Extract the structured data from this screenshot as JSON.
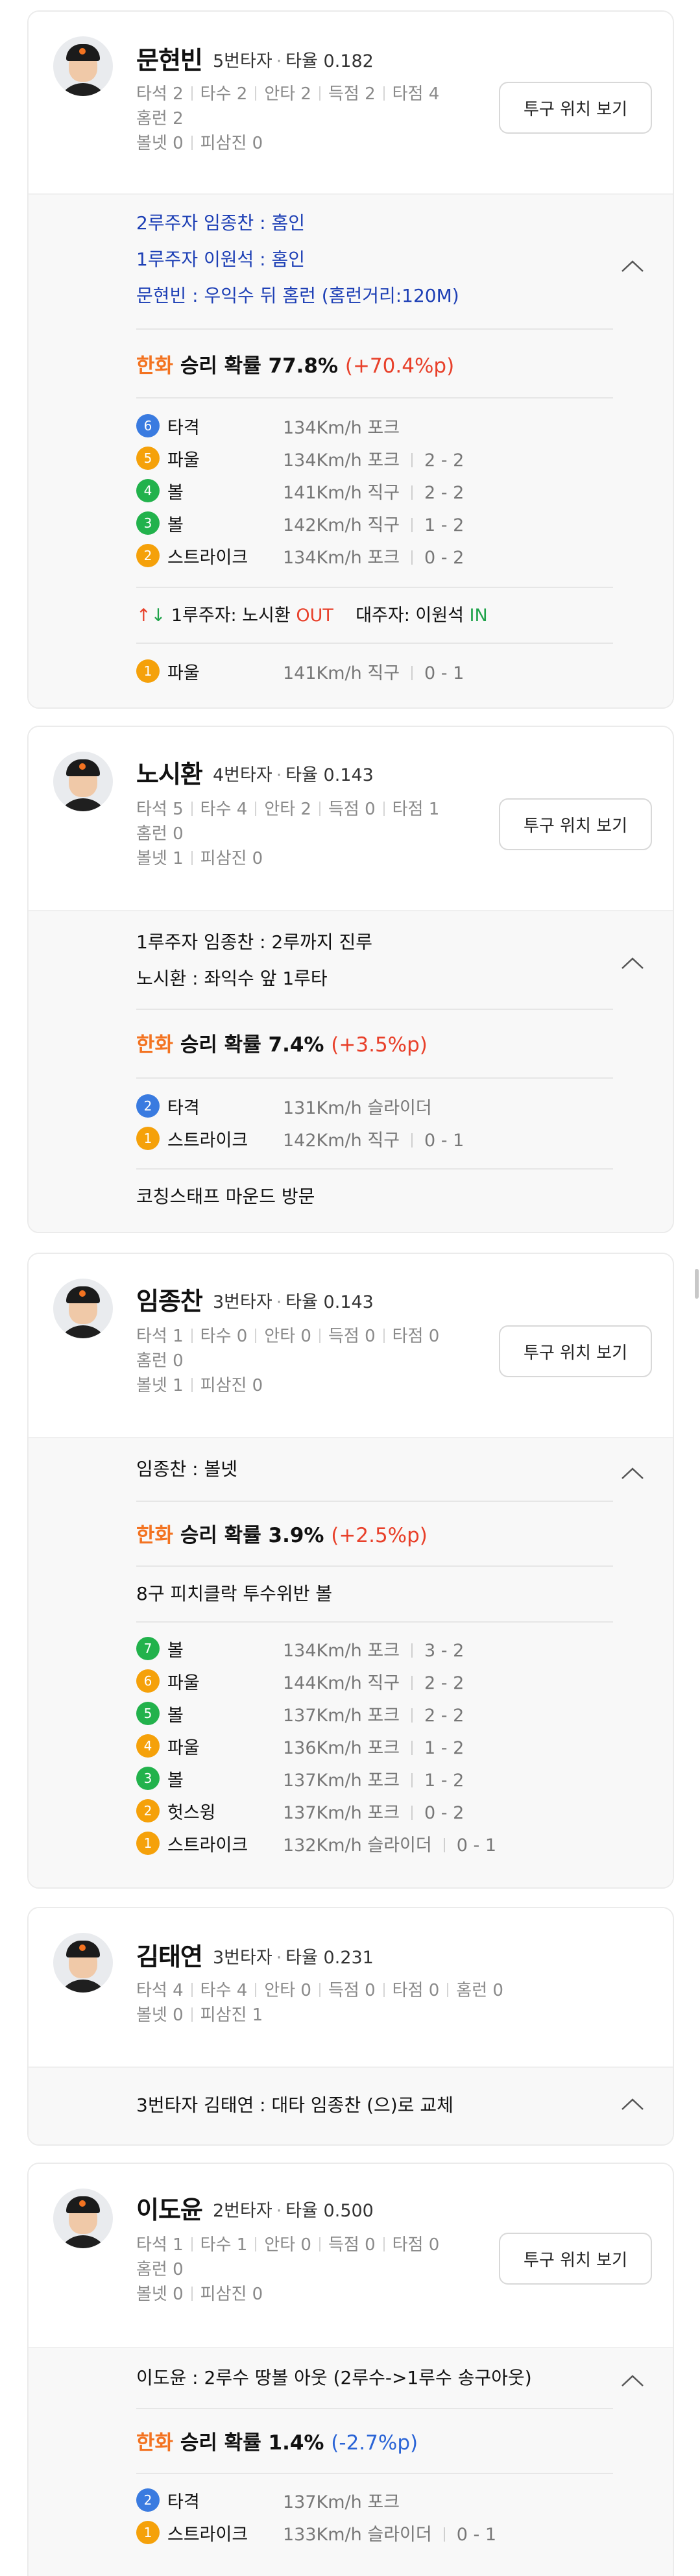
{
  "colors": {
    "team_orange": "#f37321",
    "gain_red": "#e8402a",
    "loss_blue": "#2a64d6",
    "text_blue": "#1d3fb5",
    "strike_orange": "#f5a10a",
    "ball_green": "#22b24c",
    "hit_blue": "#3a7be0",
    "foul_orange": "#f5a10a",
    "swing_orange": "#f5a10a"
  },
  "pitch_button_label": "투구 위치 보기",
  "batters": [
    {
      "name": "문현빈",
      "order": "5번타자",
      "avg": "타율 0.182",
      "stats": [
        "타석 2",
        "타수 2",
        "안타 2",
        "득점 2",
        "타점 4",
        "홈런 2",
        "볼넷 0",
        "피삼진 0"
      ],
      "lines": [
        "2루주자 임종찬 : 홈인",
        "1루주자 이원석 : 홈인",
        "문현빈 : 우익수 뒤 홈런 (홈런거리:120M)"
      ],
      "prob": {
        "team": "한화",
        "label": "승리 확률",
        "value": "77.8%",
        "change": "(+70.4%p)"
      },
      "pitches": [
        {
          "num": "6",
          "type": "타격",
          "speed": "134Km/h",
          "kind": "포크",
          "count": ""
        },
        {
          "num": "5",
          "type": "파울",
          "speed": "134Km/h",
          "kind": "포크",
          "count": "2 - 2"
        },
        {
          "num": "4",
          "type": "볼",
          "speed": "141Km/h",
          "kind": "직구",
          "count": "2 - 2"
        },
        {
          "num": "3",
          "type": "볼",
          "speed": "142Km/h",
          "kind": "직구",
          "count": "1 - 2"
        },
        {
          "num": "2",
          "type": "스트라이크",
          "speed": "134Km/h",
          "kind": "포크",
          "count": "0 - 2"
        }
      ],
      "runner_change": {
        "arrow_up": "↑",
        "arrow_down": "↓",
        "runner": "1루주자: 노시환",
        "out": "OUT",
        "sub": "대주자: 이원석",
        "in": "IN"
      },
      "pitches2": [
        {
          "num": "1",
          "type": "파울",
          "speed": "141Km/h",
          "kind": "직구",
          "count": "0 - 1"
        }
      ]
    },
    {
      "name": "노시환",
      "order": "4번타자",
      "avg": "타율 0.143",
      "stats": [
        "타석 5",
        "타수 4",
        "안타 2",
        "득점 0",
        "타점 1",
        "홈런 0",
        "볼넷 1",
        "피삼진 0"
      ],
      "lines": [
        "1루주자 임종찬 : 2루까지 진루",
        "노시환 : 좌익수 앞 1루타"
      ],
      "prob": {
        "team": "한화",
        "label": "승리 확률",
        "value": "7.4%",
        "change": "(+3.5%p)"
      },
      "pitches": [
        {
          "num": "2",
          "type": "타격",
          "speed": "131Km/h",
          "kind": "슬라이더",
          "count": ""
        },
        {
          "num": "1",
          "type": "스트라이크",
          "speed": "142Km/h",
          "kind": "직구",
          "count": "0 - 1"
        }
      ],
      "note": "코칭스태프 마운드 방문"
    },
    {
      "name": "임종찬",
      "order": "3번타자",
      "avg": "타율 0.143",
      "stats": [
        "타석 1",
        "타수 0",
        "안타 0",
        "득점 0",
        "타점 0",
        "홈런 0",
        "볼넷 1",
        "피삼진 0"
      ],
      "lines": [
        "임종찬 : 볼넷"
      ],
      "prob": {
        "team": "한화",
        "label": "승리 확률",
        "value": "3.9%",
        "change": "(+2.5%p)"
      },
      "note": "8구 피치클락 투수위반 볼",
      "pitches": [
        {
          "num": "7",
          "type": "볼",
          "speed": "134Km/h",
          "kind": "포크",
          "count": "3 - 2"
        },
        {
          "num": "6",
          "type": "파울",
          "speed": "144Km/h",
          "kind": "직구",
          "count": "2 - 2"
        },
        {
          "num": "5",
          "type": "볼",
          "speed": "137Km/h",
          "kind": "포크",
          "count": "2 - 2"
        },
        {
          "num": "4",
          "type": "파울",
          "speed": "136Km/h",
          "kind": "포크",
          "count": "1 - 2"
        },
        {
          "num": "3",
          "type": "볼",
          "speed": "137Km/h",
          "kind": "포크",
          "count": "1 - 2"
        },
        {
          "num": "2",
          "type": "헛스윙",
          "speed": "137Km/h",
          "kind": "포크",
          "count": "0 - 2"
        },
        {
          "num": "1",
          "type": "스트라이크",
          "speed": "132Km/h",
          "kind": "슬라이더",
          "count": "0 - 1"
        }
      ]
    },
    {
      "name": "김태연",
      "order": "3번타자",
      "avg": "타율 0.231",
      "stats": [
        "타석 4",
        "타수 4",
        "안타 0",
        "득점 0",
        "타점 0",
        "홈런 0",
        "볼넷 0",
        "피삼진 1"
      ],
      "lines": [
        "3번타자 김태연 : 대타 임종찬 (으)로 교체"
      ]
    },
    {
      "name": "이도윤",
      "order": "2번타자",
      "avg": "타율 0.500",
      "stats": [
        "타석 1",
        "타수 1",
        "안타 0",
        "득점 0",
        "타점 0",
        "홈런 0",
        "볼넷 0",
        "피삼진 0"
      ],
      "lines": [
        "이도윤 : 2루수 땅볼 아웃 (2루수->1루수 송구아웃)"
      ],
      "prob": {
        "team": "한화",
        "label": "승리 확률",
        "value": "1.4%",
        "change": "(-2.7%p)"
      },
      "pitches": [
        {
          "num": "2",
          "type": "타격",
          "speed": "137Km/h",
          "kind": "포크",
          "count": ""
        },
        {
          "num": "1",
          "type": "스트라이크",
          "speed": "133Km/h",
          "kind": "슬라이더",
          "count": "0 - 1"
        }
      ]
    }
  ]
}
